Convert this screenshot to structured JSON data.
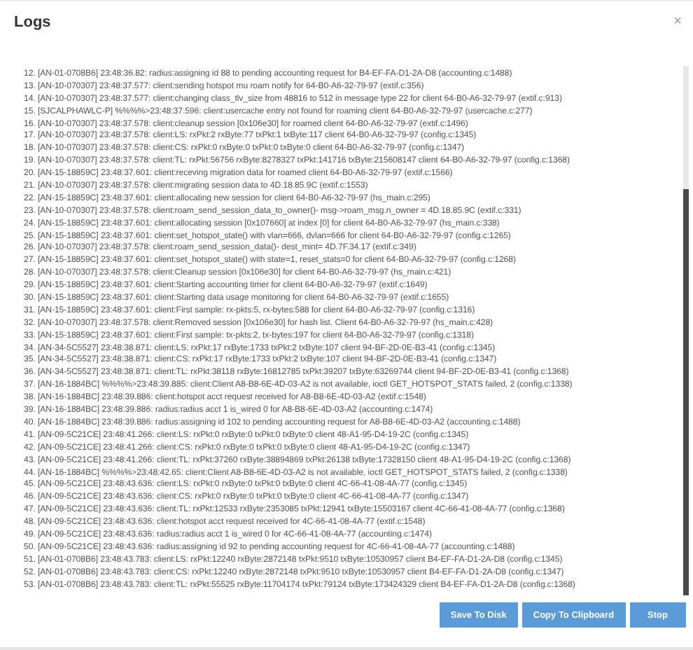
{
  "dialog": {
    "title": "Logs",
    "close": "×"
  },
  "log_lines": [
    "12. [AN-01-0708B6] 23:48:36.82: radius:assigning id 88 to pending accounting request for B4-EF-FA-D1-2A-D8 (accounting.c:1488)",
    "13. [AN-10-070307] 23:48:37.577: client:sending hotspot mu roam notify for 64-B0-A6-32-79-97 (extif.c:356)",
    "14. [AN-10-070307] 23:48:37.577: client:changing class_tlv_size from 48816 to 512 in message type 22 for client 64-B0-A6-32-79-97 (extif.c:913)",
    "15. [SJCALPHAWLC-P] %%%%>23:48:37.596: client:usercache entry not found for roaming client 64-B0-A6-32-79-97 (usercache.c:277)",
    "16. [AN-10-070307] 23:48:37.578: client:cleanup session [0x106e30] for roamed client 64-B0-A6-32-79-97 (extif.c:1496)",
    "17. [AN-10-070307] 23:48:37.578: client:LS: rxPkt:2 rxByte:77 txPkt:1 txByte:117 client 64-B0-A6-32-79-97 (config.c:1345)",
    "18. [AN-10-070307] 23:48:37.578: client:CS: rxPkt:0 rxByte:0 txPkt:0 txByte:0 client 64-B0-A6-32-79-97 (config.c:1347)",
    "19. [AN-10-070307] 23:48:37.578: client:TL: rxPkt:56756 rxByte:8278327 txPkt:141716 txByte:215608147 client 64-B0-A6-32-79-97 (config.c:1368)",
    "20. [AN-15-18859C] 23:48:37.601: client:receving migration data for roamed client 64-B0-A6-32-79-97 (extif.c:1566)",
    "21. [AN-10-070307] 23:48:37.578: client:migrating session data to 4D.18.85.9C (extif.c:1553)",
    "22. [AN-15-18859C] 23:48:37.601: client:allocating new session for client 64-B0-A6-32-79-97 (hs_main.c:295)",
    "23. [AN-10-070307] 23:48:37.578: client:roam_send_session_data_to_owner()- msg->roam_msg.n_owner = 4D.18.85.9C (extif.c:331)",
    "24. [AN-15-18859C] 23:48:37.601: client:allocating session [0x107660] at index [0] for client 64-B0-A6-32-79-97 (hs_main.c:338)",
    "25. [AN-15-18859C] 23:48:37.601: client:set_hotspot_state() with vlan=666, dvlan=666 for client 64-B0-A6-32-79-97 (config.c:1265)",
    "26. [AN-10-070307] 23:48:37.578: client:roam_send_session_data()- dest_mint= 4D.7F.34.17 (extif.c:349)",
    "27. [AN-15-18859C] 23:48:37.601: client:set_hotspot_state() with state=1, reset_stats=0 for client 64-B0-A6-32-79-97 (config.c:1268)",
    "28. [AN-10-070307] 23:48:37.578: client:Cleanup session [0x106e30] for client 64-B0-A6-32-79-97 (hs_main.c:421)",
    "29. [AN-15-18859C] 23:48:37.601: client:Starting accounting timer for client 64-B0-A6-32-79-97 (extif.c:1649)",
    "30. [AN-15-18859C] 23:48:37.601: client:Starting data usage monitoring for client 64-B0-A6-32-79-97 (extif.c:1655)",
    "31. [AN-15-18859C] 23:48:37.601: client:First sample: rx-pkts:5, rx-bytes:588 for client 64-B0-A6-32-79-97 (config.c:1316)",
    "32. [AN-10-070307] 23:48:37.578: client:Removed session [0x106e30] for hash list. Client 64-B0-A6-32-79-97 (hs_main.c:428)",
    "33. [AN-15-18859C] 23:48:37.601: client:First sample: tx-pkts:2, tx-bytes:197 for client 64-B0-A6-32-79-97 (config.c:1318)",
    "34. [AN-34-5C5527] 23:48:38.871: client:LS: rxPkt:17 rxByte:1733 txPkt:2 txByte:107 client 94-BF-2D-0E-B3-41 (config.c:1345)",
    "35. [AN-34-5C5527] 23:48:38.871: client:CS: rxPkt:17 rxByte:1733 txPkt:2 txByte:107 client 94-BF-2D-0E-B3-41 (config.c:1347)",
    "36. [AN-34-5C5527] 23:48:38.871: client:TL: rxPkt:38118 rxByte:16812785 txPkt:39207 txByte:63269744 client 94-BF-2D-0E-B3-41 (config.c:1368)",
    "37. [AN-16-1884BC] %%%%>23:48:39.885: client:Client A8-B8-6E-4D-03-A2 is not available, ioctl GET_HOTSPOT_STATS failed, 2 (config.c:1338)",
    "38. [AN-16-1884BC] 23:48:39.886: client:hotspot acct request received for A8-B8-6E-4D-03-A2 (extif.c:1548)",
    "39. [AN-16-1884BC] 23:48:39.886: radius:radius acct 1 is_wired 0 for A8-B8-6E-4D-03-A2 (accounting.c:1474)",
    "40. [AN-16-1884BC] 23:48:39.886: radius:assigning id 102 to pending accounting request for A8-B8-6E-4D-03-A2 (accounting.c:1488)",
    "41. [AN-09-5C21CE] 23:48:41.266: client:LS: rxPkt:0 rxByte:0 txPkt:0 txByte:0 client 48-A1-95-D4-19-2C (config.c:1345)",
    "42. [AN-09-5C21CE] 23:48:41.266: client:CS: rxPkt:0 rxByte:0 txPkt:0 txByte:0 client 48-A1-95-D4-19-2C (config.c:1347)",
    "43. [AN-09-5C21CE] 23:48:41.266: client:TL: rxPkt:37260 rxByte:38894869 txPkt:26138 txByte:17328150 client 48-A1-95-D4-19-2C (config.c:1368)",
    "44. [AN-16-1884BC] %%%%>23:48:42.65: client:Client A8-B8-6E-4D-03-A2 is not available, ioctl GET_HOTSPOT_STATS failed, 2 (config.c:1338)",
    "45. [AN-09-5C21CE] 23:48:43.636: client:LS: rxPkt:0 rxByte:0 txPkt:0 txByte:0 client 4C-66-41-08-4A-77 (config.c:1345)",
    "46. [AN-09-5C21CE] 23:48:43.636: client:CS: rxPkt:0 rxByte:0 txPkt:0 txByte:0 client 4C-66-41-08-4A-77 (config.c:1347)",
    "47. [AN-09-5C21CE] 23:48:43.636: client:TL: rxPkt:12533 rxByte:2353085 txPkt:12941 txByte:15503167 client 4C-66-41-08-4A-77 (config.c:1368)",
    "48. [AN-09-5C21CE] 23:48:43.636: client:hotspot acct request received for 4C-66-41-08-4A-77 (extif.c:1548)",
    "49. [AN-09-5C21CE] 23:48:43.636: radius:radius acct 1 is_wired 0 for 4C-66-41-08-4A-77 (accounting.c:1474)",
    "50. [AN-09-5C21CE] 23:48:43.636: radius:assigning id 92 to pending accounting request for 4C-66-41-08-4A-77 (accounting.c:1488)",
    "51. [AN-01-0708B6] 23:48:43.783: client:LS: rxPkt:12240 rxByte:2872148 txPkt:9510 txByte:10530957 client B4-EF-FA-D1-2A-D8 (config.c:1345)",
    "52. [AN-01-0708B6] 23:48:43.783: client:CS: rxPkt:12240 rxByte:2872148 txPkt:9510 txByte:10530957 client B4-EF-FA-D1-2A-D8 (config.c:1347)",
    "53. [AN-01-0708B6] 23:48:43.783: client:TL: rxPkt:55525 rxByte:11704174 txPkt:79124 txByte:173424329 client B4-EF-FA-D1-2A-D8 (config.c:1368)"
  ],
  "buttons": [
    "Save To Disk",
    "Copy To Clipboard",
    "Stop"
  ]
}
